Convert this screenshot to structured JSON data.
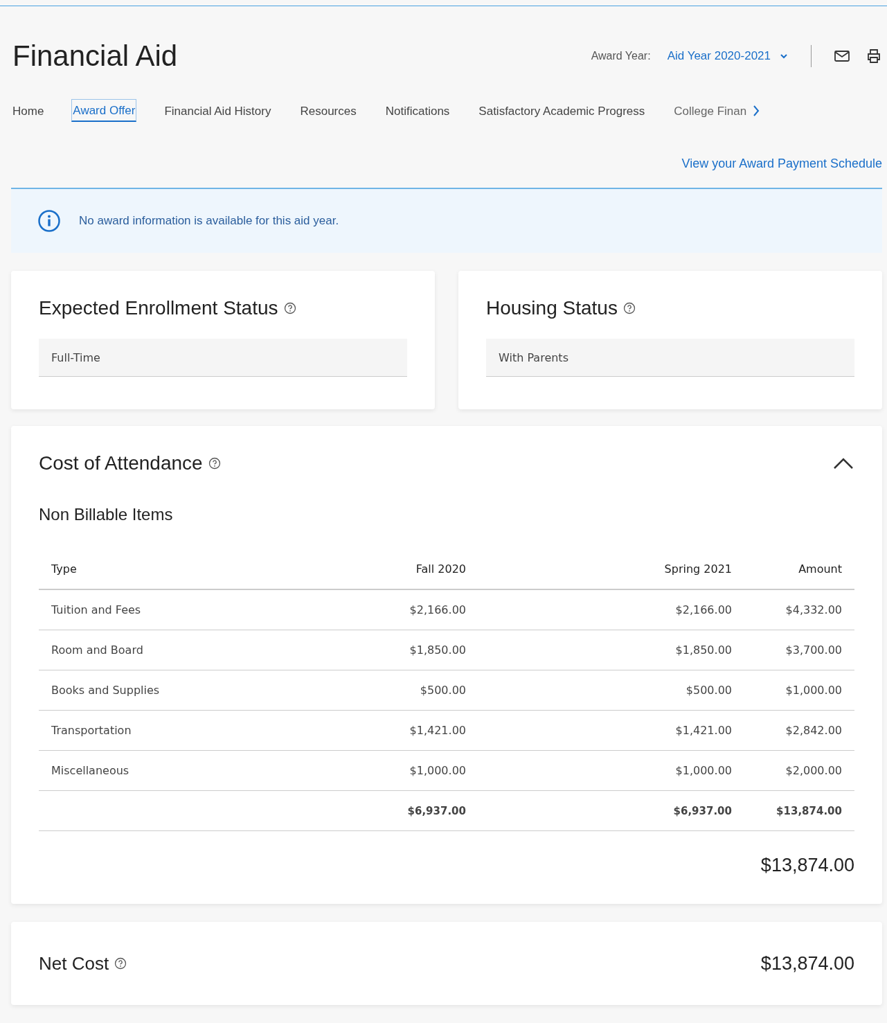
{
  "header": {
    "title": "Financial Aid",
    "award_year_label": "Award Year:",
    "award_year_value": "Aid Year 2020-2021"
  },
  "tabs": [
    {
      "label": "Home",
      "selected": false
    },
    {
      "label": "Award Offer",
      "selected": true
    },
    {
      "label": "Financial Aid History",
      "selected": false
    },
    {
      "label": "Resources",
      "selected": false
    },
    {
      "label": "Notifications",
      "selected": false
    },
    {
      "label": "Satisfactory Academic Progress",
      "selected": false
    },
    {
      "label": "College Finan",
      "selected": false
    }
  ],
  "payment_schedule_link": "View your Award Payment Schedule",
  "info_banner": "No award information is available for this aid year.",
  "status_cards": [
    {
      "title": "Expected Enrollment Status",
      "value": "Full-Time"
    },
    {
      "title": "Housing Status",
      "value": "With Parents"
    }
  ],
  "cost_of_attendance": {
    "title": "Cost of Attendance",
    "expanded": true,
    "subtitle": "Non Billable Items",
    "columns": [
      "Type",
      "Fall 2020",
      "Spring 2021",
      "Amount"
    ],
    "rows": [
      [
        "Tuition and Fees",
        "$2,166.00",
        "$2,166.00",
        "$4,332.00"
      ],
      [
        "Room and Board",
        "$1,850.00",
        "$1,850.00",
        "$3,700.00"
      ],
      [
        "Books and Supplies",
        "$500.00",
        "$500.00",
        "$1,000.00"
      ],
      [
        "Transportation",
        "$1,421.00",
        "$1,421.00",
        "$2,842.00"
      ],
      [
        "Miscellaneous",
        "$1,000.00",
        "$1,000.00",
        "$2,000.00"
      ]
    ],
    "totals": [
      "$6,937.00",
      "$6,937.00",
      "$13,874.00"
    ],
    "grand_total": "$13,874.00"
  },
  "net_cost": {
    "title": "Net Cost",
    "value": "$13,874.00"
  }
}
